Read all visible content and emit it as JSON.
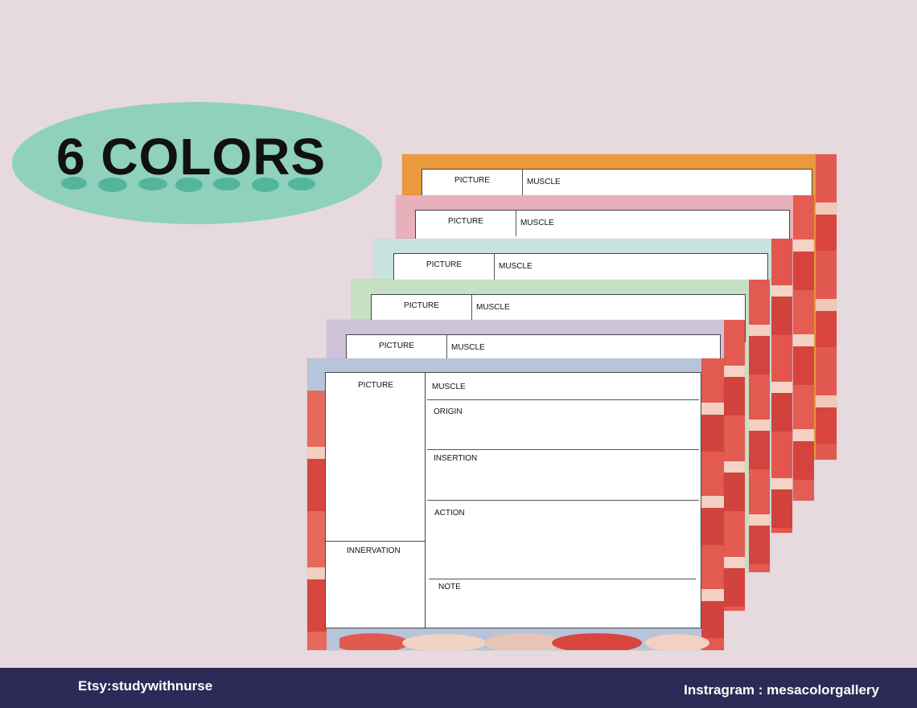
{
  "badge": {
    "text": "6 COLORS",
    "color": "#8fd1bc"
  },
  "cards": [
    {
      "color": "#e99a3d",
      "picture_label": "PICTURE",
      "muscle_label": "MUSCLE"
    },
    {
      "color": "#e7b0ba",
      "picture_label": "PICTURE",
      "muscle_label": "MUSCLE"
    },
    {
      "color": "#c7e2df",
      "picture_label": "PICTURE",
      "muscle_label": "MUSCLE"
    },
    {
      "color": "#c6e0c3",
      "picture_label": "PICTURE",
      "muscle_label": "MUSCLE"
    },
    {
      "color": "#cec3d9",
      "picture_label": "PICTURE",
      "muscle_label": "MUSCLE"
    }
  ],
  "front_card": {
    "color": "#b7c4da",
    "picture_label": "PICTURE",
    "innervation_label": "INNERVATION",
    "muscle_label": "MUSCLE",
    "origin_label": "ORIGIN",
    "insertion_label": "INSERTION",
    "action_label": "ACTION",
    "note_label": "NOTE"
  },
  "footer": {
    "etsy": "Etsy:studywithnurse",
    "instagram": "Instragram : mesacolorgallery",
    "color": "#2e2a57"
  }
}
